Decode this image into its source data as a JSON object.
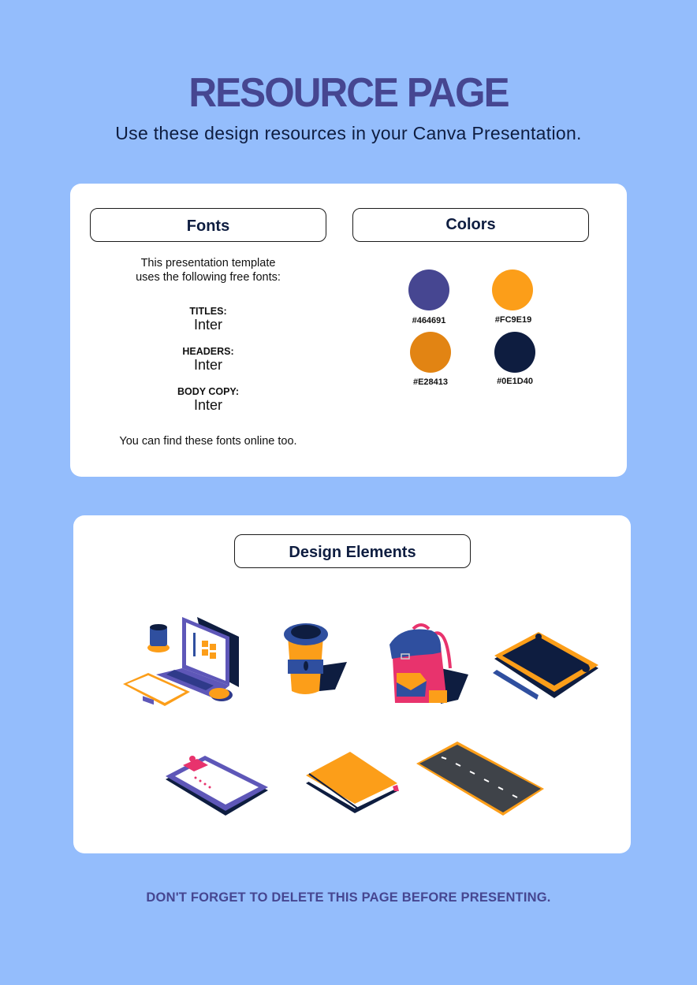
{
  "header": {
    "title": "RESOURCE PAGE",
    "subtitle": "Use these design resources in your Canva Presentation."
  },
  "fonts_section": {
    "heading": "Fonts",
    "intro_line1": "This presentation template",
    "intro_line2": "uses the following free fonts:",
    "items": [
      {
        "label": "TITLES:",
        "value": "Inter"
      },
      {
        "label": "HEADERS:",
        "value": "Inter"
      },
      {
        "label": "BODY COPY:",
        "value": "Inter"
      }
    ],
    "footer": "You can find these fonts online too."
  },
  "colors_section": {
    "heading": "Colors",
    "swatches": [
      {
        "label": "#464691",
        "color": "#464691"
      },
      {
        "label": "#FC9E19",
        "color": "#FC9E19"
      },
      {
        "label": "#E28413",
        "color": "#E28413"
      },
      {
        "label": "#0E1D40",
        "color": "#0E1D40"
      }
    ]
  },
  "design_elements": {
    "heading": "Design Elements",
    "items": [
      "laptop-workspace-illustration",
      "coffee-cup-illustration",
      "backpack-illustration",
      "drawing-tablet-illustration",
      "clipboard-illustration",
      "notebook-illustration",
      "road-illustration"
    ]
  },
  "footer": {
    "warning": "DON'T FORGET TO DELETE THIS PAGE BEFORE PRESENTING."
  },
  "theme": {
    "background": "#94BDFC",
    "title_color": "#464691",
    "text_dark": "#0E1D40"
  }
}
